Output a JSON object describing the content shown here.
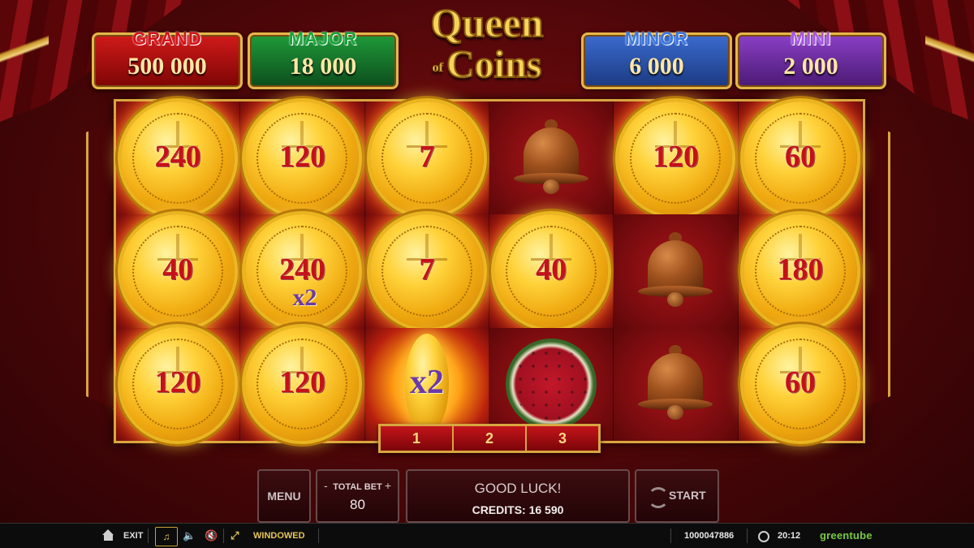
{
  "logo": {
    "line1": "Queen",
    "of": "of",
    "line2": "Coins"
  },
  "jackpots": [
    {
      "label": "GRAND",
      "value": "500 000"
    },
    {
      "label": "MAJOR",
      "value": "18 000"
    },
    {
      "label": "MINOR",
      "value": "6 000"
    },
    {
      "label": "MINI",
      "value": "2 000"
    }
  ],
  "reels": {
    "rows": [
      [
        "240",
        "120",
        "7",
        "bell",
        "120",
        "60"
      ],
      [
        "40",
        "240",
        "7",
        "40",
        "bell",
        "180"
      ],
      [
        "120",
        "120",
        "x2",
        "watermelon",
        "bell",
        "60"
      ]
    ],
    "multiplier_on_coin": "x2",
    "tall_coin_multiplier": "x2"
  },
  "counter": [
    "1",
    "2",
    "3"
  ],
  "controls": {
    "menu": "MENU",
    "total_bet_label": "TOTAL BET",
    "bet_minus": "-",
    "bet_plus": "+",
    "total_bet_value": "80",
    "message": "GOOD LUCK!",
    "credits": "CREDITS: 16 590",
    "start": "START"
  },
  "bottom_bar": {
    "exit": "EXIT",
    "windowed": "WINDOWED",
    "session_id": "1000047886",
    "time": "20:12",
    "brand": "greentube"
  },
  "colors": {
    "grand": "#d4141a",
    "major": "#1aa33a",
    "minor": "#3a78e0",
    "mini": "#a655e6",
    "frame_gold": "#d8a640"
  }
}
